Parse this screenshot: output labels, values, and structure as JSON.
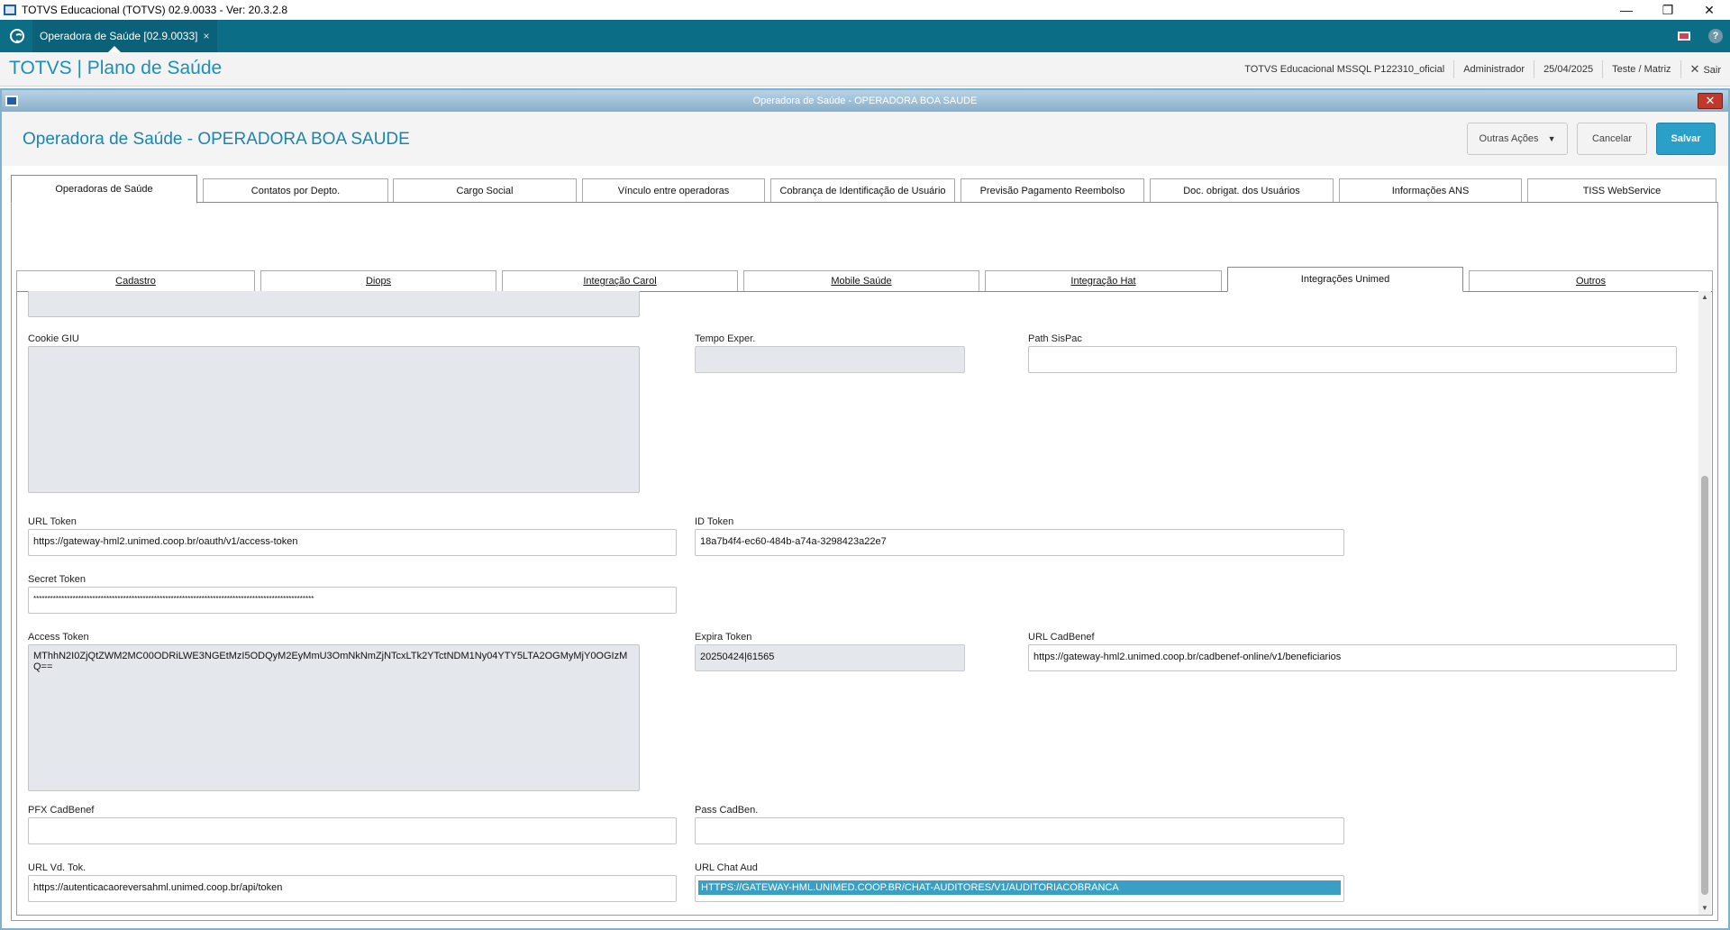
{
  "os": {
    "window_title": "TOTVS Educacional (TOTVS) 02.9.0033 - Ver: 20.3.2.8",
    "minimize": "—",
    "restore": "❐",
    "close": "✕"
  },
  "app_tabbar": {
    "tab_label": "Operadora de Saúde [02.9.0033]",
    "tab_close": "×",
    "help": "?"
  },
  "header": {
    "brand": "TOTVS | Plano de Saúde",
    "environment": "TOTVS Educacional MSSQL P122310_oficial",
    "user": "Administrador",
    "date": "25/04/2025",
    "company": "Teste / Matriz",
    "exit_label": "Sair",
    "exit_icon": "✕"
  },
  "dialog": {
    "title": "Operadora de Saúde - OPERADORA BOA SAUDE",
    "close": "✕",
    "page_title": "Operadora de Saúde - OPERADORA BOA SAUDE",
    "buttons": {
      "more": "Outras Ações",
      "more_caret": "▼",
      "cancel": "Cancelar",
      "save": "Salvar"
    }
  },
  "top_tabs": [
    "Operadoras de Saúde",
    "Contatos por Depto.",
    "Cargo Social",
    "Vínculo entre operadoras",
    "Cobrança de Identificação de Usuário",
    "Previsão Pagamento Reembolso",
    "Doc. obrigat. dos Usuários",
    "Informações ANS",
    "TISS WebService"
  ],
  "inner_tabs": [
    "Cadastro",
    "Diops",
    "Integração Carol",
    "Mobile Saúde",
    "Integração Hat",
    "Integrações Unimed",
    "Outros"
  ],
  "scroll": {
    "up": "▲",
    "down": "▼"
  },
  "fields": {
    "cookie_giu": {
      "label": "Cookie GIU",
      "value": ""
    },
    "tempo_exper": {
      "label": "Tempo Exper.",
      "value": ""
    },
    "path_sispac": {
      "label": "Path SisPac",
      "value": ""
    },
    "url_token": {
      "label": "URL Token",
      "value": "https://gateway-hml2.unimed.coop.br/oauth/v1/access-token"
    },
    "id_token": {
      "label": "ID Token",
      "value": "18a7b4f4-ec60-484b-a74a-3298423a22e7"
    },
    "secret_token": {
      "label": "Secret Token",
      "value": "****************************************************************************************************"
    },
    "access_token": {
      "label": "Access Token",
      "value": "MThhN2I0ZjQtZWM2MC00ODRiLWE3NGEtMzI5ODQyM2EyMmU3OmNkNmZjNTcxLTk2YTctNDM1Ny04YTY5LTA2OGMyMjY0OGIzMQ=="
    },
    "expira_token": {
      "label": "Expira Token",
      "value": "20250424|61565"
    },
    "url_cadbenef": {
      "label": "URL CadBenef",
      "value": "https://gateway-hml2.unimed.coop.br/cadbenef-online/v1/beneficiarios"
    },
    "pfx_cadbenef": {
      "label": "PFX CadBenef",
      "value": ""
    },
    "pass_cadben": {
      "label": "Pass CadBen.",
      "value": ""
    },
    "url_vd_tok": {
      "label": "URL Vd. Tok.",
      "value": "https://autenticacaoreversahml.unimed.coop.br/api/token"
    },
    "url_chat_aud": {
      "label": "URL Chat Aud",
      "value": "HTTPS://GATEWAY-HML.UNIMED.COOP.BR/CHAT-AUDITORES/V1/AUDITORIACOBRANCA"
    }
  }
}
